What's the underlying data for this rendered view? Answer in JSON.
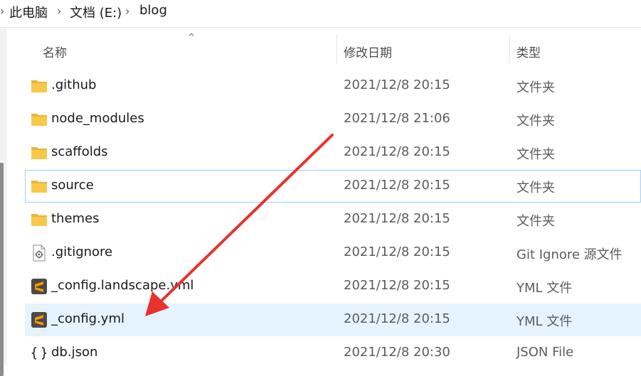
{
  "breadcrumb": {
    "items": [
      "此电脑",
      "文档 (E:)",
      "blog"
    ],
    "separator": "›"
  },
  "columns": {
    "name": "名称",
    "date": "修改日期",
    "type": "类型"
  },
  "files": [
    {
      "name": ".github",
      "date": "2021/12/8 20:15",
      "type": "文件夹",
      "icon": "folder-icon"
    },
    {
      "name": "node_modules",
      "date": "2021/12/8 21:06",
      "type": "文件夹",
      "icon": "folder-icon"
    },
    {
      "name": "scaffolds",
      "date": "2021/12/8 20:15",
      "type": "文件夹",
      "icon": "folder-icon"
    },
    {
      "name": "source",
      "date": "2021/12/8 20:15",
      "type": "文件夹",
      "icon": "folder-icon"
    },
    {
      "name": "themes",
      "date": "2021/12/8 20:15",
      "type": "文件夹",
      "icon": "folder-icon"
    },
    {
      "name": ".gitignore",
      "date": "2021/12/8 20:15",
      "type": "Git Ignore 源文件",
      "icon": "gear-file-icon"
    },
    {
      "name": "_config.landscape.yml",
      "date": "2021/12/8 20:15",
      "type": "YML 文件",
      "icon": "sublime-text-icon"
    },
    {
      "name": "_config.yml",
      "date": "2021/12/8 20:15",
      "type": "YML 文件",
      "icon": "sublime-text-icon"
    },
    {
      "name": "db.json",
      "date": "2021/12/8 20:30",
      "type": "JSON File",
      "icon": "json-file-icon"
    }
  ],
  "colors": {
    "selected_row": "#e5f3ff",
    "focus_border": "#99d1ff",
    "folder": "#f8c948",
    "sublime": "#ff9800",
    "arrow": "#e8322d"
  }
}
